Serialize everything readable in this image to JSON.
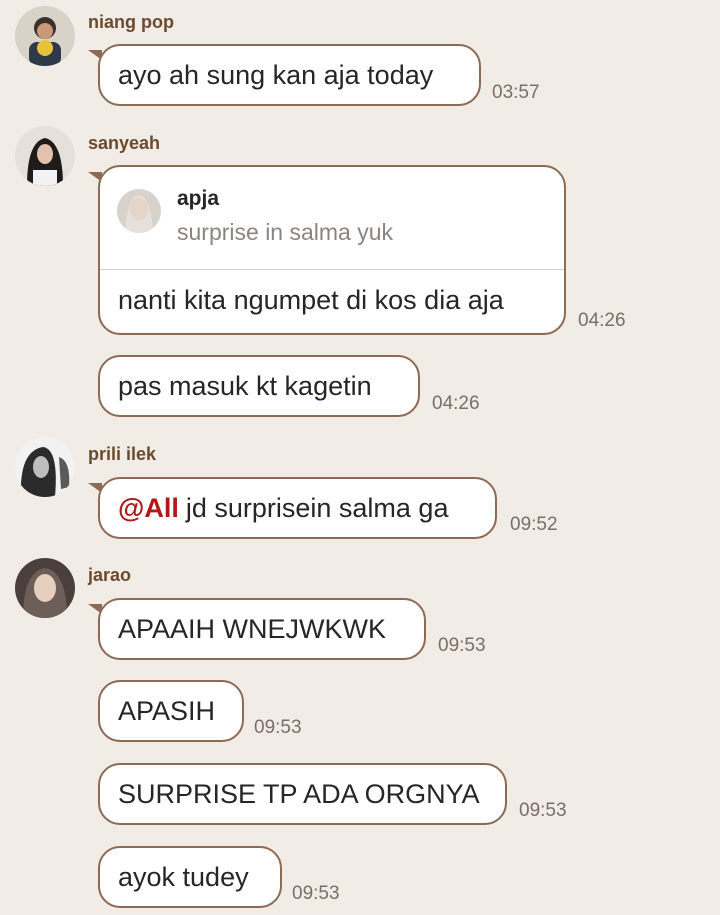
{
  "messages": [
    {
      "sender": "niang pop",
      "text": "ayo ah sung kan aja today",
      "time": "03:57"
    },
    {
      "sender": "sanyeah",
      "reply": {
        "name": "apja",
        "text": "surprise in salma yuk"
      },
      "text": "nanti kita ngumpet di kos dia aja",
      "time": "04:26"
    },
    {
      "text": "pas masuk kt kagetin",
      "time": "04:26"
    },
    {
      "sender": "prili ilek",
      "mention": "@All",
      "text": "jd surprisein salma ga",
      "time": "09:52"
    },
    {
      "sender": "jarao",
      "text": "APAAIH WNEJWKWK",
      "time": "09:53"
    },
    {
      "text": "APASIH",
      "time": "09:53"
    },
    {
      "text": "SURPRISE TP ADA ORGNYA",
      "time": "09:53"
    },
    {
      "text": "ayok tudey",
      "time": "09:53"
    }
  ],
  "colors": {
    "background": "#f1ece6",
    "bubble_border": "#8c6a54",
    "sender": "#6b4a2e",
    "mention": "#b01919"
  }
}
